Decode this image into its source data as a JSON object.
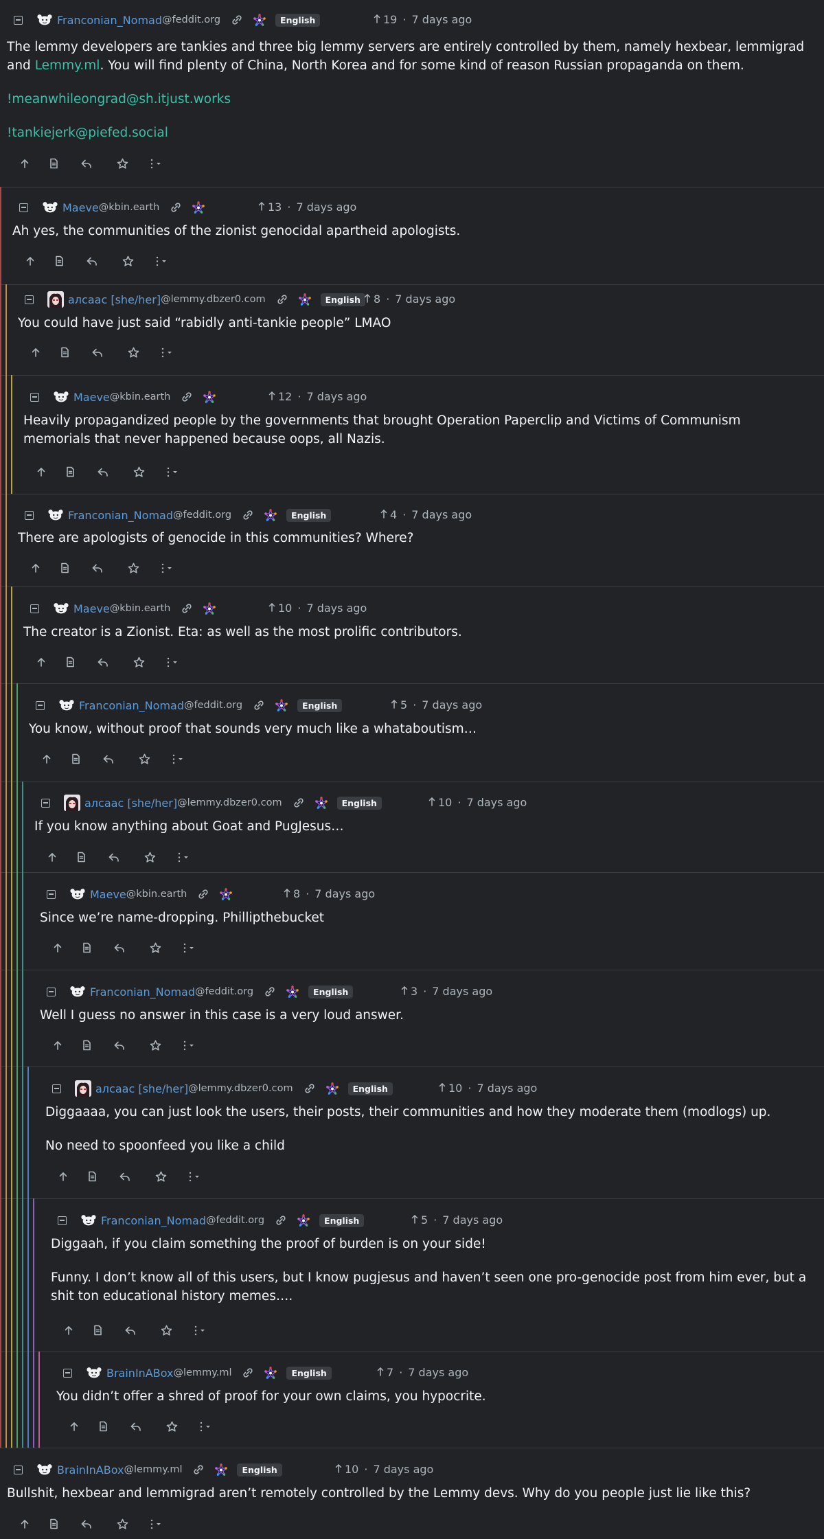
{
  "comments": [
    {
      "user": "Franconian_Nomad",
      "instance": "@feddit.org",
      "lang": "English",
      "score": "19",
      "time": "7 days ago",
      "paragraphs": [
        [
          {
            "t": "The lemmy developers are tankies and three big lemmy servers are entirely controlled by them, namely hexbear, lemmigrad and "
          },
          {
            "t": "Lemmy.ml",
            "link": true
          },
          {
            "t": ". You will find plenty of China, North Korea and for some kind of reason Russian propaganda on them."
          }
        ],
        [
          {
            "t": "!meanwhileongrad@sh.itjust.works",
            "link": true
          }
        ],
        [
          {
            "t": "!tankiejerk@piefed.social",
            "link": true
          }
        ]
      ]
    },
    {
      "user": "Maeve",
      "instance": "@kbin.earth",
      "lang": "",
      "score": "13",
      "time": "7 days ago",
      "paragraphs": [
        [
          {
            "t": "Ah yes, the communities of the zionist genocidal apartheid apologists."
          }
        ]
      ]
    },
    {
      "user": "алсаас [she/her]",
      "instance": "@lemmy.dbzer0.com",
      "lang": "English",
      "score": "8",
      "time": "7 days ago",
      "paragraphs": [
        [
          {
            "t": "You could have just said “rabidly anti-tankie people” LMAO"
          }
        ]
      ]
    },
    {
      "user": "Maeve",
      "instance": "@kbin.earth",
      "lang": "",
      "score": "12",
      "time": "7 days ago",
      "paragraphs": [
        [
          {
            "t": "Heavily propagandized people by the governments that brought Operation Paperclip and Victims of Communism memorials that never happened because oops, all Nazis."
          }
        ]
      ]
    },
    {
      "user": "Franconian_Nomad",
      "instance": "@feddit.org",
      "lang": "English",
      "score": "4",
      "time": "7 days ago",
      "paragraphs": [
        [
          {
            "t": "There are apologists of genocide in this communities? Where?"
          }
        ]
      ]
    },
    {
      "user": "Maeve",
      "instance": "@kbin.earth",
      "lang": "",
      "score": "10",
      "time": "7 days ago",
      "paragraphs": [
        [
          {
            "t": "The creator is a Zionist. Eta: as well as the most prolific contributors."
          }
        ]
      ]
    },
    {
      "user": "Franconian_Nomad",
      "instance": "@feddit.org",
      "lang": "English",
      "score": "5",
      "time": "7 days ago",
      "paragraphs": [
        [
          {
            "t": "You know, without proof that sounds very much like a whataboutism…"
          }
        ]
      ]
    },
    {
      "user": "алсаас [she/her]",
      "instance": "@lemmy.dbzer0.com",
      "lang": "English",
      "score": "10",
      "time": "7 days ago",
      "paragraphs": [
        [
          {
            "t": "If you know anything about Goat and PugJesus…"
          }
        ]
      ]
    },
    {
      "user": "Maeve",
      "instance": "@kbin.earth",
      "lang": "",
      "score": "8",
      "time": "7 days ago",
      "paragraphs": [
        [
          {
            "t": "Since we’re name-dropping. Phillipthebucket"
          }
        ]
      ]
    },
    {
      "user": "Franconian_Nomad",
      "instance": "@feddit.org",
      "lang": "English",
      "score": "3",
      "time": "7 days ago",
      "paragraphs": [
        [
          {
            "t": "Well I guess no answer in this case is a very loud answer."
          }
        ]
      ]
    },
    {
      "user": "алсаас [she/her]",
      "instance": "@lemmy.dbzer0.com",
      "lang": "English",
      "score": "10",
      "time": "7 days ago",
      "paragraphs": [
        [
          {
            "t": "Diggaaaa, you can just look the users, their posts, their communities and how they moderate them (modlogs) up."
          }
        ],
        [
          {
            "t": "No need to spoonfeed you like a child"
          }
        ]
      ]
    },
    {
      "user": "Franconian_Nomad",
      "instance": "@feddit.org",
      "lang": "English",
      "score": "5",
      "time": "7 days ago",
      "paragraphs": [
        [
          {
            "t": "Diggaah, if you claim something the proof of burden is on your side!"
          }
        ],
        [
          {
            "t": "Funny. I don’t know all of this users, but I know pugjesus and haven’t seen one pro-genocide post from him ever, but a shit ton educational history memes…."
          }
        ]
      ]
    },
    {
      "user": "BrainInABox",
      "instance": "@lemmy.ml",
      "lang": "English",
      "score": "7",
      "time": "7 days ago",
      "paragraphs": [
        [
          {
            "t": "You didn’t offer a shred of proof for your own claims, you hypocrite."
          }
        ]
      ]
    },
    {
      "user": "BrainInABox",
      "instance": "@lemmy.ml",
      "lang": "English",
      "score": "10",
      "time": "7 days ago",
      "paragraphs": [
        [
          {
            "t": "Bullshit, hexbear and lemmigrad aren’t remotely controlled by the Lemmy devs. Why do you people just lie like this?"
          }
        ]
      ]
    }
  ],
  "colors": {
    "background": "#222326",
    "text": "#f1f3f5",
    "username": "#5e9bd6",
    "link": "#3cc0a8",
    "muted": "#adb5bd",
    "thread_lines": [
      "#a14a4a",
      "#c88a40",
      "#b8a63a",
      "#4f9f5a",
      "#3f8f8a",
      "#4a7fc0",
      "#8a5fc0",
      "#c05a9a",
      "#9aa03a"
    ]
  },
  "icons": [
    "collapse-icon",
    "avatar-icon",
    "link-icon",
    "fediverse-icon",
    "upvote-arrow-icon",
    "upvote-icon",
    "source-icon",
    "reply-icon",
    "save-star-icon",
    "more-options-icon"
  ]
}
